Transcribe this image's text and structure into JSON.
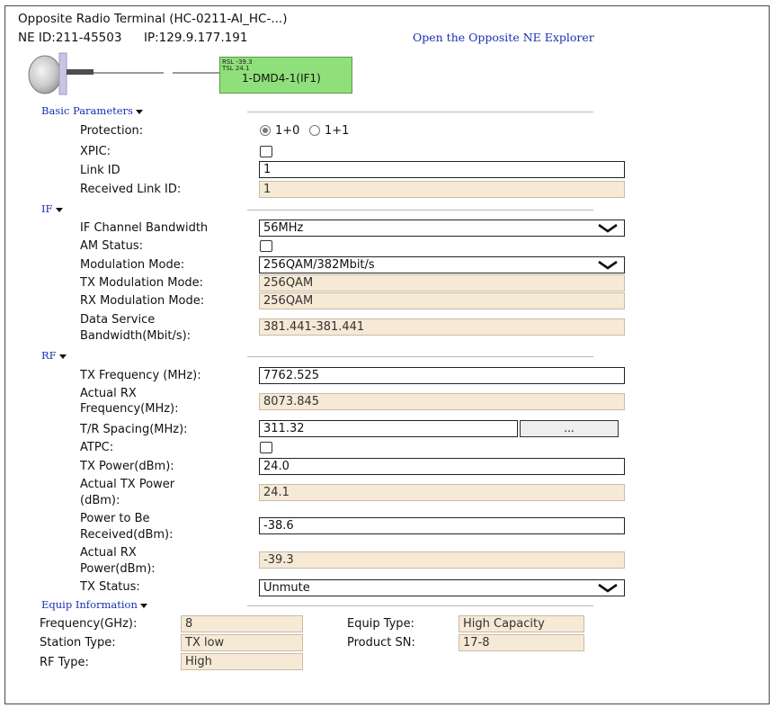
{
  "header": {
    "title": "Opposite Radio Terminal (HC-0211-AI_HC-...)",
    "ne_id": "NE ID:211-45503",
    "ip": "IP:129.9.177.191",
    "explorer_link": "Open the Opposite NE Explorer"
  },
  "topology": {
    "rsl": "RSL -39.3",
    "tsl": "TSL 24.1",
    "board": "1-DMD4-1(IF1)"
  },
  "basic": {
    "section": "Basic Parameters",
    "protection_label": "Protection:",
    "protection_options": [
      "1+0",
      "1+1"
    ],
    "protection_selected": "1+0",
    "xpic_label": "XPIC:",
    "xpic_checked": false,
    "link_id_label": "Link ID",
    "link_id": "1",
    "received_link_id_label": "Received Link ID:",
    "received_link_id": "1"
  },
  "if": {
    "section": "IF",
    "bandwidth_label": "IF Channel Bandwidth",
    "bandwidth": "56MHz",
    "am_label": "AM Status:",
    "am_checked": false,
    "modulation_label": "Modulation Mode:",
    "modulation": "256QAM/382Mbit/s",
    "tx_mod_label": "TX Modulation Mode:",
    "tx_mod": "256QAM",
    "rx_mod_label": "RX Modulation Mode:",
    "rx_mod": "256QAM",
    "data_bw_label_1": "Data Service",
    "data_bw_label_2": "Bandwidth(Mbit/s):",
    "data_bw": "381.441-381.441"
  },
  "rf": {
    "section": "RF",
    "tx_freq_label": "TX Frequency (MHz):",
    "tx_freq": "7762.525",
    "actual_rx_label_1": "Actual RX",
    "actual_rx_label_2": "Frequency(MHz):",
    "actual_rx_freq": "8073.845",
    "tr_spacing_label": "T/R Spacing(MHz):",
    "tr_spacing": "311.32",
    "tr_button": "...",
    "atpc_label": "ATPC:",
    "atpc_checked": false,
    "tx_power_label": "TX Power(dBm):",
    "tx_power": "24.0",
    "actual_tx_label_1": "Actual TX Power",
    "actual_tx_label_2": "(dBm):",
    "actual_tx_power": "24.1",
    "ptbr_label_1": "Power to Be",
    "ptbr_label_2": "Received(dBm):",
    "ptbr": "-38.6",
    "actual_rxp_label_1": "Actual RX",
    "actual_rxp_label_2": "Power(dBm):",
    "actual_rx_power": "-39.3",
    "tx_status_label": "TX Status:",
    "tx_status": "Unmute"
  },
  "equip": {
    "section": "Equip Information",
    "frequency_label": "Frequency(GHz):",
    "frequency": "8",
    "station_label": "Station Type:",
    "station": "TX low",
    "rf_type_label": "RF Type:",
    "rf_type": "High",
    "equip_type_label": "Equip Type:",
    "equip_type": "High Capacity",
    "product_sn_label": "Product SN:",
    "product_sn": "17-8"
  },
  "colors": {
    "link": "#1a2fb0",
    "readonly_bg": "#f6e9d5",
    "board_green": "#8fe07a"
  }
}
